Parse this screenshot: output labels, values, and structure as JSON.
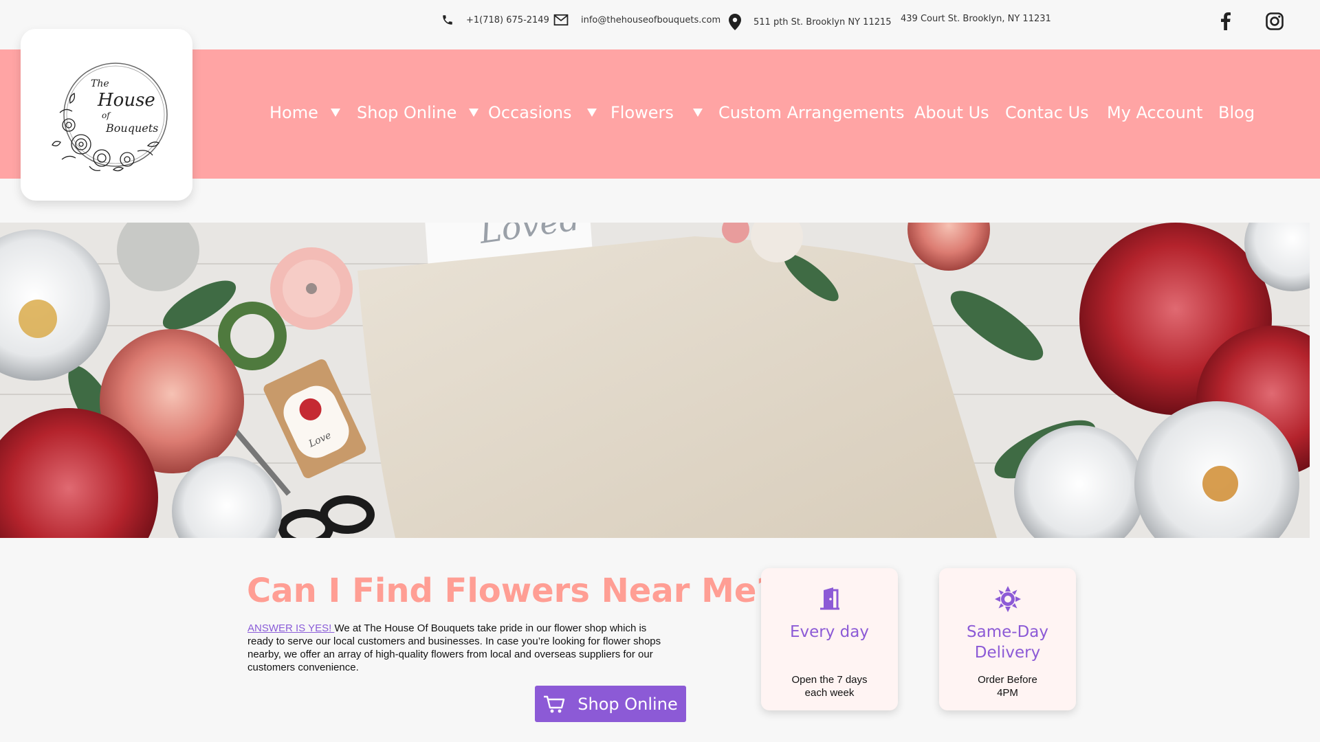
{
  "topbar": {
    "phone": "+1(718) 675-2149",
    "email": "info@thehouseofbouquets.com",
    "address1": "511 pth St. Brooklyn NY 11215",
    "address2": "439 Court St. Brooklyn, NY 11231"
  },
  "logo": {
    "line1": "The",
    "line2": "House",
    "line3": "of",
    "line4": "Bouquets"
  },
  "nav": {
    "items": [
      {
        "label": "Home",
        "dropdown": true,
        "active": true
      },
      {
        "label": "Shop Online",
        "dropdown": true
      },
      {
        "label": "Occasions",
        "dropdown": true
      },
      {
        "label": "Flowers",
        "dropdown": true
      },
      {
        "label": "Custom Arrangements",
        "dropdown": false
      },
      {
        "label": "About Us",
        "dropdown": false
      },
      {
        "label": "Contac Us",
        "dropdown": false
      },
      {
        "label": "My Account",
        "dropdown": false
      },
      {
        "label": "Blog",
        "dropdown": false
      }
    ]
  },
  "hero": {
    "card_text": "Loved",
    "tag_text": "Love"
  },
  "content": {
    "heading": "Can I Find Flowers Near Me?",
    "answer_link": "ANSWER IS YES! ",
    "paragraph": "We at The House Of Bouquets take pride in our flower shop which is ready to serve our local customers and businesses. In case you’re looking for flower shops nearby, we offer an array of high-quality flowers from local and overseas suppliers for our customers convenience.",
    "shop_button": "Shop Online"
  },
  "cards": [
    {
      "title": "Every day",
      "sub_line1": "Open the 7 days",
      "sub_line2": "each week",
      "icon": "door-icon"
    },
    {
      "title_line1": "Same-Day",
      "title_line2": "Delivery",
      "sub_line1": "Order Before",
      "sub_line2": "4PM",
      "icon": "sun-icon"
    }
  ],
  "colors": {
    "brand_pink": "#ffa4a4",
    "accent_purple": "#8c5ad6",
    "heading_pink": "#ff9e94"
  }
}
